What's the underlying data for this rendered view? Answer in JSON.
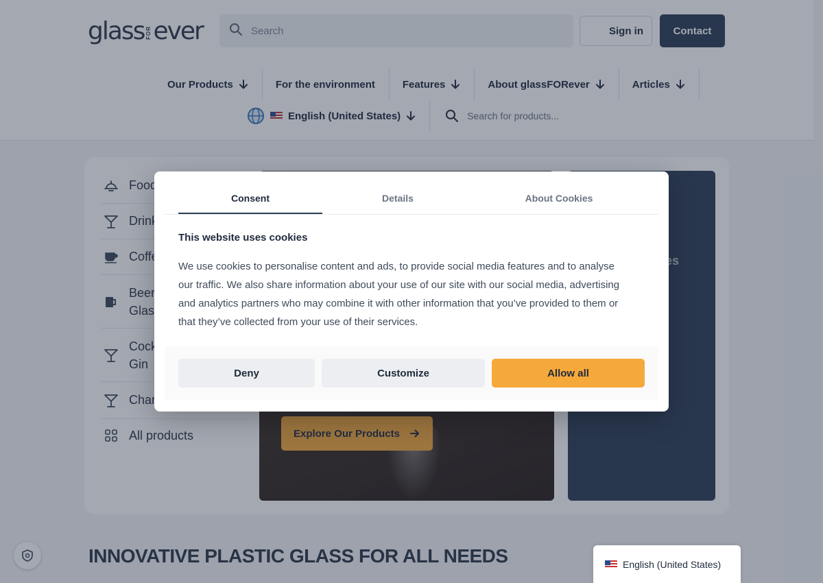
{
  "header": {
    "logo": {
      "part1": "glass",
      "part2": "FOR",
      "part3": "ever"
    },
    "search_placeholder": "Search",
    "sign_in": "Sign in",
    "contact": "Contact"
  },
  "nav": {
    "items": [
      {
        "label": "Our Products",
        "has_arrow": true
      },
      {
        "label": "For the environment",
        "has_arrow": false
      },
      {
        "label": "Features",
        "has_arrow": true
      },
      {
        "label": "About glassFORever",
        "has_arrow": true
      },
      {
        "label": "Articles",
        "has_arrow": true
      }
    ],
    "language": "English (United States)",
    "product_search_placeholder": "Search for products..."
  },
  "categories": [
    {
      "label": "Food",
      "icon": "food-icon"
    },
    {
      "label": "Drink",
      "icon": "cocktail-glass-icon"
    },
    {
      "label": "Coffe",
      "icon": "coffee-cup-icon"
    },
    {
      "label": "Beer Glas",
      "icon": "beer-mug-icon"
    },
    {
      "label": "Cock Gin",
      "icon": "cocktail-glass-icon"
    },
    {
      "label": "Char",
      "icon": "cocktail-glass-icon"
    },
    {
      "label": "All products",
      "icon": "grid-icon"
    }
  ],
  "hero": {
    "explore_label": "Explore Our Products"
  },
  "side_card": {
    "text_line1": "e",
    "text_line2": "ses"
  },
  "section_title": "INNOVATIVE PLASTIC GLASS FOR ALL NEEDS",
  "language_float": "English (United States)",
  "consent": {
    "tabs": [
      "Consent",
      "Details",
      "About Cookies"
    ],
    "active_tab": 0,
    "title": "This website uses cookies",
    "body": "We use cookies to personalise content and ads, to provide social media features and to analyse our traffic. We also share information about your use of our site with our social media, advertising and analytics partners who may combine it with other information that you’ve provided to them or that they’ve collected from your use of their services.",
    "deny": "Deny",
    "customize": "Customize",
    "allow_all": "Allow all"
  },
  "colors": {
    "accent_orange": "#f6a93b",
    "primary_navy": "#2e3d55",
    "overlay": "rgba(35,48,70,0.42)"
  }
}
